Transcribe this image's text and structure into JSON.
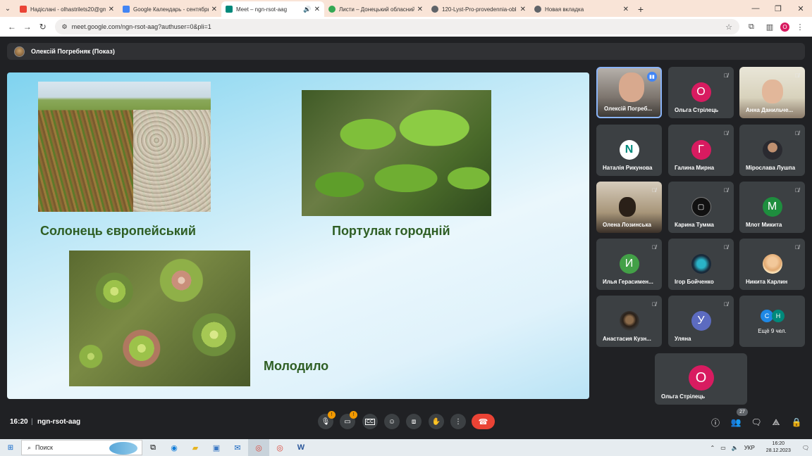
{
  "browser": {
    "tabs": [
      {
        "title": "Надіслані - olhastrilets20@gm",
        "favicon_color": "#ea4335",
        "active": false
      },
      {
        "title": "Google Календарь - сентябрь",
        "favicon_color": "#4285f4",
        "active": false
      },
      {
        "title": "Meet – ngn-rsot-aag",
        "favicon_color": "#00897b",
        "active": true
      },
      {
        "title": "Листи – Донецький обласний",
        "favicon_color": "#34a853",
        "active": false
      },
      {
        "title": "120-Lyst-Pro-provedennia-obl",
        "favicon_color": "#5f6368",
        "active": false
      },
      {
        "title": "Новая вкладка",
        "favicon_color": "#5f6368",
        "active": false
      }
    ],
    "url": "meet.google.com/ngn-rsot-aag?authuser=0&pli=1",
    "profile_initial": "O"
  },
  "meet": {
    "presenter_label": "Олексій Погребняк (Показ)",
    "slide": {
      "captions": [
        "Солонець європейський",
        "Портулак городній",
        "Молодило"
      ]
    },
    "participants": [
      {
        "name": "Олексій Погреб...",
        "type": "video",
        "speaking": true
      },
      {
        "name": "Ольга Стрілець",
        "type": "initial",
        "initial": "О",
        "color": "#d81b60"
      },
      {
        "name": "Анна Данильче...",
        "type": "video"
      },
      {
        "name": "Наталія Рикунова",
        "type": "logo",
        "initial": "N",
        "color": "#ffffff"
      },
      {
        "name": "Галина Мирна",
        "type": "initial",
        "initial": "Г",
        "color": "#d81b60"
      },
      {
        "name": "Мірослава Лушпа",
        "type": "photo"
      },
      {
        "name": "Олена Лозинська",
        "type": "video"
      },
      {
        "name": "Карина Тумма",
        "type": "photo"
      },
      {
        "name": "Млот Микита",
        "type": "initial",
        "initial": "М",
        "color": "#1e8e3e"
      },
      {
        "name": "Илья Герасимен...",
        "type": "initial",
        "initial": "И",
        "color": "#43a047"
      },
      {
        "name": "Ігор Бойченко",
        "type": "photo"
      },
      {
        "name": "Никита Карлин",
        "type": "photo"
      },
      {
        "name": "Анастасия Кузн...",
        "type": "photo"
      },
      {
        "name": "Уляна",
        "type": "initial",
        "initial": "У",
        "color": "#5c6bc0"
      },
      {
        "name": "Ольга Стрілець",
        "type": "initial",
        "initial": "О",
        "color": "#d81b60"
      }
    ],
    "more": {
      "label": "Ещё 9 чел.",
      "initials": [
        "С",
        "Н"
      ],
      "colors": [
        "#1e88e5",
        "#00897b"
      ]
    },
    "bottom": {
      "time": "16:20",
      "separator": "|",
      "meeting_code": "ngn-rsot-aag",
      "participant_count": "27"
    }
  },
  "taskbar": {
    "search_label": "Поиск",
    "language": "УКР",
    "time": "16:20",
    "date": "28.12.2023"
  }
}
